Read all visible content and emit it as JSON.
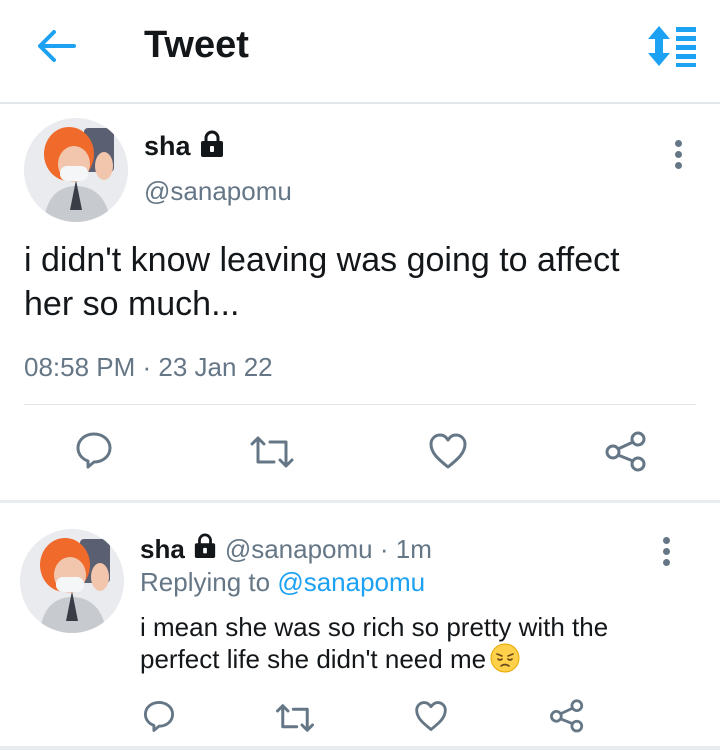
{
  "header": {
    "title": "Tweet",
    "back_icon": "arrow-left-icon",
    "sort_icon": "sort-updown-icon",
    "accent_color": "#1da1f2"
  },
  "main_tweet": {
    "display_name": "sha",
    "handle": "@sanapomu",
    "text_line1": "i didn't know leaving was going to affect",
    "text_line2": "her so much...",
    "time": "08:58 PM",
    "separator": " · ",
    "date": "23 Jan 22",
    "actions": [
      "reply-icon",
      "retweet-icon",
      "like-icon",
      "share-icon"
    ]
  },
  "reply_tweet": {
    "display_name": "sha",
    "handle": "@sanapomu",
    "separator": " · ",
    "age": "1m",
    "replying_prefix": "Replying to ",
    "replying_to": "@sanapomu",
    "text_line1": "i mean she was so rich so pretty with the",
    "text_line2": "perfect life she didn't need me",
    "emoji": "pensive-face-emoji",
    "actions": [
      "reply-icon",
      "retweet-icon",
      "like-icon",
      "share-icon"
    ]
  }
}
